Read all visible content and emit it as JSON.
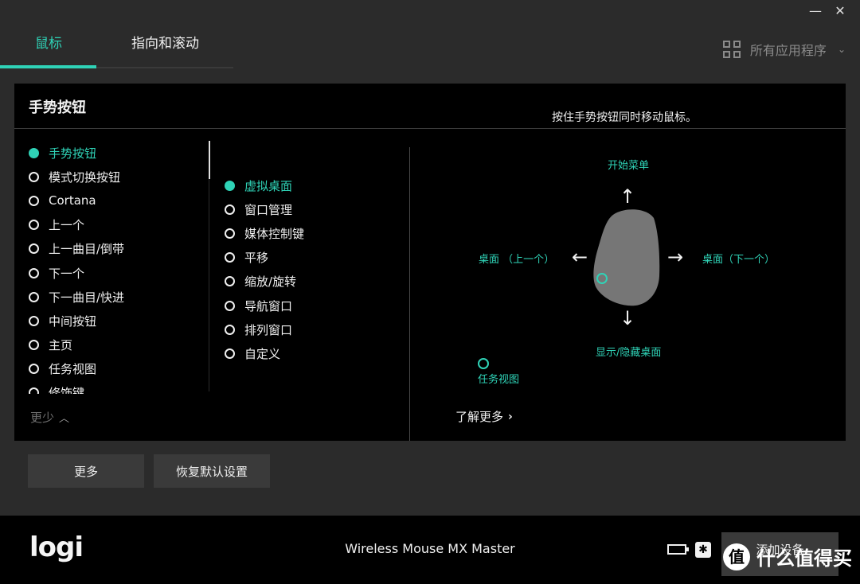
{
  "window": {
    "minimize": "—",
    "close": "✕"
  },
  "tabs": [
    {
      "label": "鼠标",
      "active": true
    },
    {
      "label": "指向和滚动",
      "active": false
    }
  ],
  "apps": {
    "label": "所有应用程序",
    "icon": "grid-icon"
  },
  "panel": {
    "title": "手势按钮",
    "hint": "按住手势按钮同时移动鼠标。",
    "left_items": [
      {
        "label": "手势按钮",
        "active": true
      },
      {
        "label": "模式切换按钮",
        "active": false
      },
      {
        "label": "Cortana",
        "active": false
      },
      {
        "label": "上一个",
        "active": false
      },
      {
        "label": "上一曲目/倒带",
        "active": false
      },
      {
        "label": "下一个",
        "active": false
      },
      {
        "label": "下一曲目/快进",
        "active": false
      },
      {
        "label": "中间按钮",
        "active": false
      },
      {
        "label": "主页",
        "active": false
      },
      {
        "label": "任务视图",
        "active": false
      },
      {
        "label": "修饰键",
        "active": false
      }
    ],
    "less_label": "更少",
    "mid_items": [
      {
        "label": "虚拟桌面",
        "active": true
      },
      {
        "label": "窗口管理",
        "active": false
      },
      {
        "label": "媒体控制键",
        "active": false
      },
      {
        "label": "平移",
        "active": false
      },
      {
        "label": "缩放/旋转",
        "active": false
      },
      {
        "label": "导航窗口",
        "active": false
      },
      {
        "label": "排列窗口",
        "active": false
      },
      {
        "label": "自定义",
        "active": false
      }
    ],
    "gestures": {
      "up": "开始菜单",
      "left": "桌面 （上一个）",
      "right": "桌面（下一个）",
      "down": "显示/隐藏桌面",
      "click": "任务视图"
    },
    "learn_more": "了解更多"
  },
  "buttons": {
    "more": "更多",
    "reset": "恢复默认设置"
  },
  "footer": {
    "logo": "logi",
    "device_name": "Wireless Mouse MX Master",
    "add_device": "添加设备"
  },
  "watermark": {
    "text": "什么值得买",
    "icon": "值"
  },
  "colors": {
    "accent": "#2fd3b7",
    "panel_bg": "#000000",
    "window_bg": "#2b2b2b",
    "button_bg": "#3a3a3a"
  }
}
